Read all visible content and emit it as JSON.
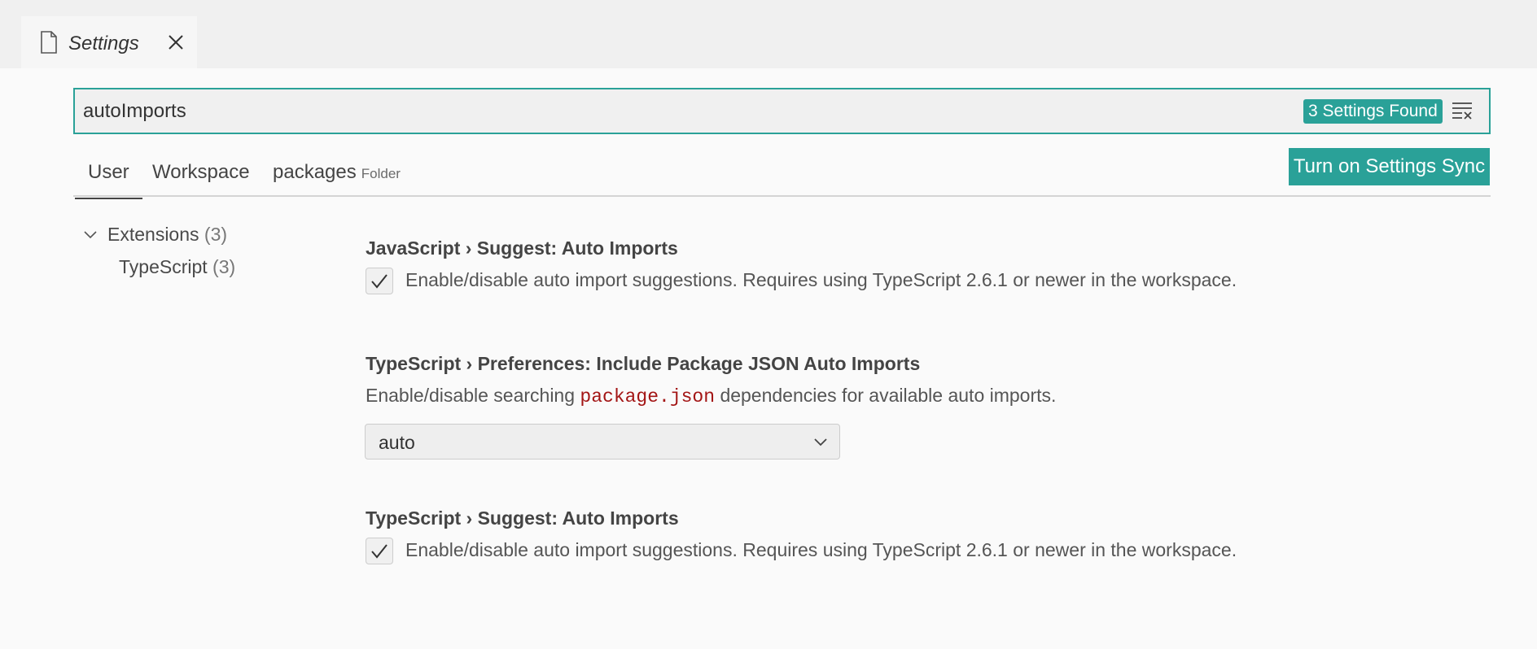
{
  "tab": {
    "icon": "file-icon",
    "label": "Settings",
    "close_icon": "close-icon"
  },
  "search": {
    "value": "autoImports",
    "result_count": "3 Settings Found",
    "filter_icon": "clear-filter-icon"
  },
  "scope_tabs": {
    "user": "User",
    "workspace": "Workspace",
    "folder": "packages",
    "folder_sub": "Folder",
    "active": "User"
  },
  "sync_button": "Turn on Settings Sync",
  "toc": {
    "extensions": {
      "label": "Extensions",
      "count": "(3)"
    },
    "typescript": {
      "label": "TypeScript",
      "count": "(3)"
    }
  },
  "settings": [
    {
      "title": "JavaScript › Suggest: Auto Imports",
      "description": "Enable/disable auto import suggestions. Requires using TypeScript 2.6.1 or newer in the workspace.",
      "checked": true
    },
    {
      "title": "TypeScript › Preferences: Include Package JSON Auto Imports",
      "desc_pre": "Enable/disable searching",
      "desc_code": "package.json",
      "desc_post": "dependencies for available auto imports.",
      "select_value": "auto"
    },
    {
      "title": "TypeScript › Suggest: Auto Imports",
      "description": "Enable/disable auto import suggestions. Requires using TypeScript 2.6.1 or newer in the workspace.",
      "checked": true
    }
  ],
  "colors": {
    "accent": "#2aa198",
    "code": "#a31515",
    "background": "#fafafa"
  }
}
